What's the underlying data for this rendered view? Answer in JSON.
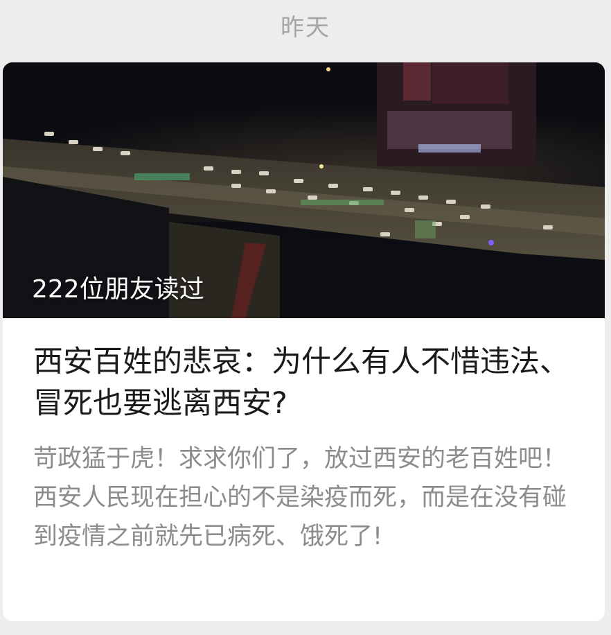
{
  "date_label": "昨天",
  "article": {
    "read_count": "222位朋友读过",
    "title": "西安百姓的悲哀：为什么有人不惜违法、冒死也要逃离西安?",
    "summary": "苛政猛于虎！求求你们了，放过西安的老百姓吧！西安人民现在担心的不是染疫而死，而是在没有碰到疫情之前就先已病死、饿死了!"
  }
}
